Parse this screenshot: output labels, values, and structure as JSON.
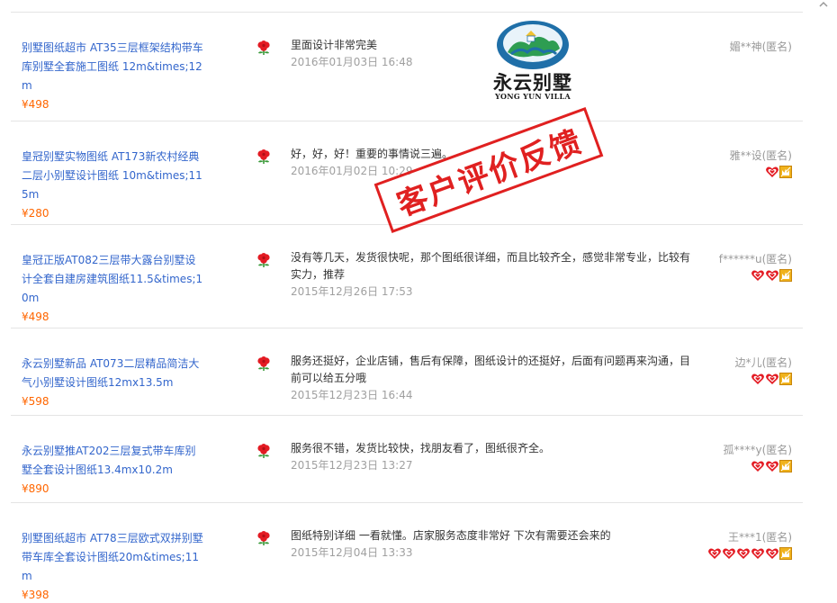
{
  "reviews": [
    {
      "product_title": "别墅图纸超市 AT35三层框架结构带车库别墅全套施工图纸 12m&times;12m",
      "price": "¥498",
      "comment": "里面设计非常完美",
      "date": "2016年01月03日 16:48",
      "user": "媚**神(匿名)",
      "badge_count": 0
    },
    {
      "product_title": "皇冠别墅实物图纸 AT173新农村经典二层小别墅设计图纸 10m&times;115m",
      "price": "¥280",
      "comment": "好，好，好！重要的事情说三遍。",
      "date": "2016年01月02日 10:29",
      "user": "雅**设(匿名)",
      "badge_count": 1
    },
    {
      "product_title": "皇冠正版AT082三层带大露台别墅设计全套自建房建筑图纸11.5&times;10m",
      "price": "¥498",
      "comment": "没有等几天，发货很快呢，那个图纸很详细，而且比较齐全，感觉非常专业，比较有实力，推荐",
      "date": "2015年12月26日 17:53",
      "user": "f******u(匿名)",
      "badge_count": 2
    },
    {
      "product_title": "永云别墅新品 AT073二层精品简洁大气小别墅设计图纸12mx13.5m",
      "price": "¥598",
      "comment": "服务还挺好，企业店铺，售后有保障，图纸设计的还挺好，后面有问题再来沟通，目前可以给五分哦",
      "date": "2015年12月23日 16:44",
      "user": "边*儿(匿名)",
      "badge_count": 2
    },
    {
      "product_title": "永云别墅推AT202三层复式带车库别墅全套设计图纸13.4mx10.2m",
      "price": "¥890",
      "comment": "服务很不错，发货比较快，找朋友看了，图纸很齐全。",
      "date": "2015年12月23日 13:27",
      "user": "孤****y(匿名)",
      "badge_count": 2
    },
    {
      "product_title": "别墅图纸超市 AT78三层欧式双拼别墅带车库全套设计图纸20m&times;11m",
      "price": "¥398",
      "comment": "图纸特别详细 一看就懂。店家服务态度非常好 下次有需要还会来的",
      "date": "2015年12月04日 13:33",
      "user": "王***1(匿名)",
      "badge_count": 5
    }
  ],
  "logo": {
    "title": "永云别墅",
    "subtitle": "YONG YUN VILLA"
  },
  "stamp": {
    "text": "客户评价反馈"
  },
  "colors": {
    "link": "#3366cc",
    "price": "#ff6600",
    "date": "#a0a0a0",
    "stamp": "#e02020",
    "flower": "#e31b23"
  },
  "icons": {
    "flower": "rose-icon",
    "heart": "heart-badge-icon",
    "crown": "crown-badge-icon"
  }
}
